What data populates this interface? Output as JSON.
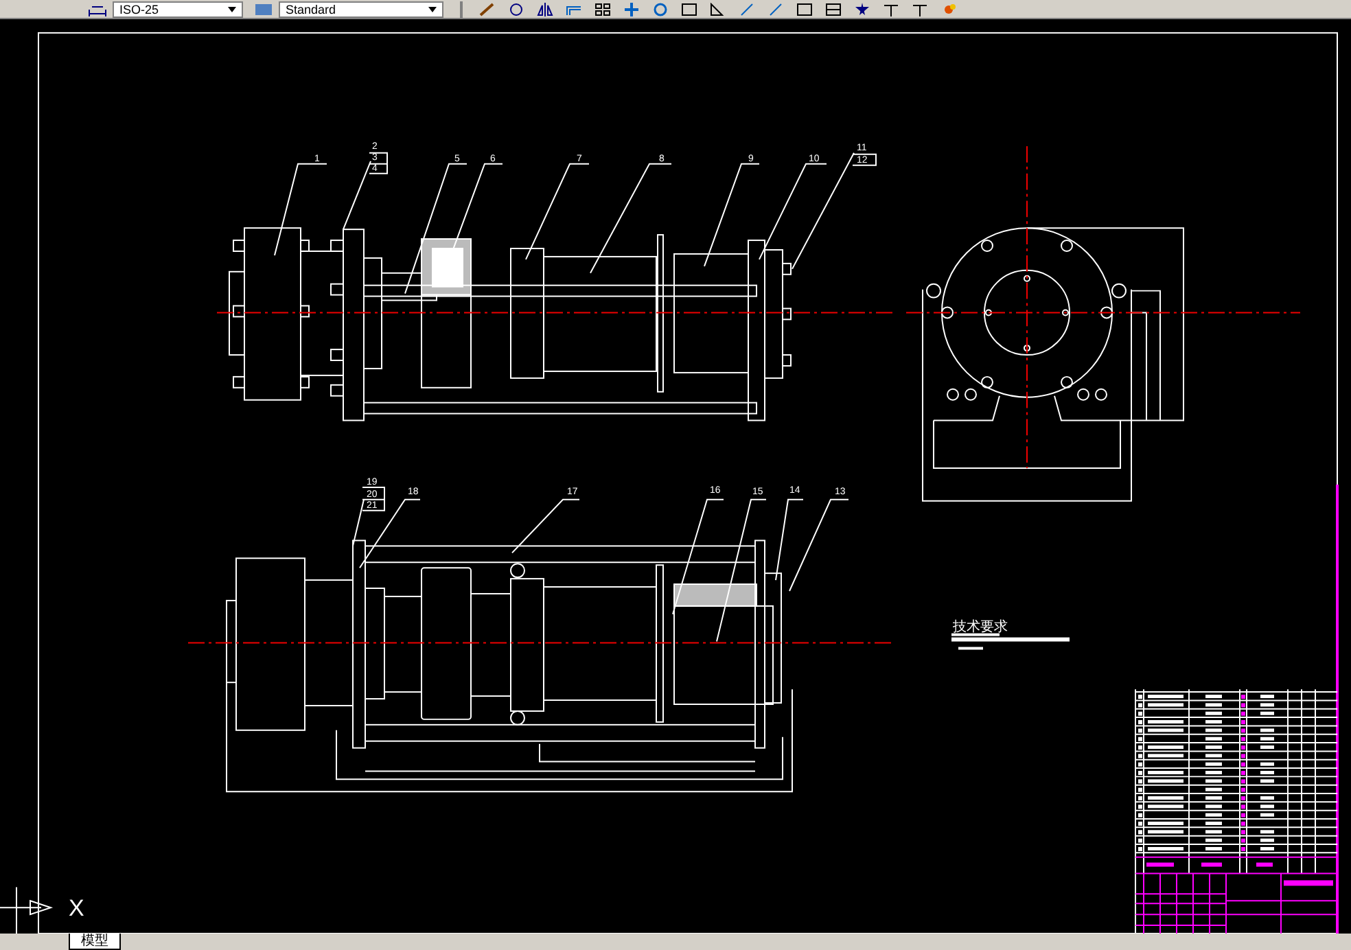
{
  "toolbar": {
    "dimension_style": "ISO-25",
    "text_style": "Standard"
  },
  "drawing": {
    "balloons": [
      {
        "label": "1"
      },
      {
        "label": "2"
      },
      {
        "label": "3"
      },
      {
        "label": "4"
      },
      {
        "label": "5"
      },
      {
        "label": "6"
      },
      {
        "label": "7"
      },
      {
        "label": "8"
      },
      {
        "label": "9"
      },
      {
        "label": "10"
      },
      {
        "label": "11"
      },
      {
        "label": "12"
      },
      {
        "label": "19"
      },
      {
        "label": "20"
      },
      {
        "label": "21"
      },
      {
        "label": "18"
      },
      {
        "label": "17"
      },
      {
        "label": "16"
      },
      {
        "label": "15"
      },
      {
        "label": "14"
      },
      {
        "label": "13"
      }
    ],
    "notes_heading": "技术要求"
  },
  "ucs": {
    "axis_label": "X"
  },
  "layout_tabs": [
    {
      "label": "模型",
      "selected": true
    }
  ]
}
